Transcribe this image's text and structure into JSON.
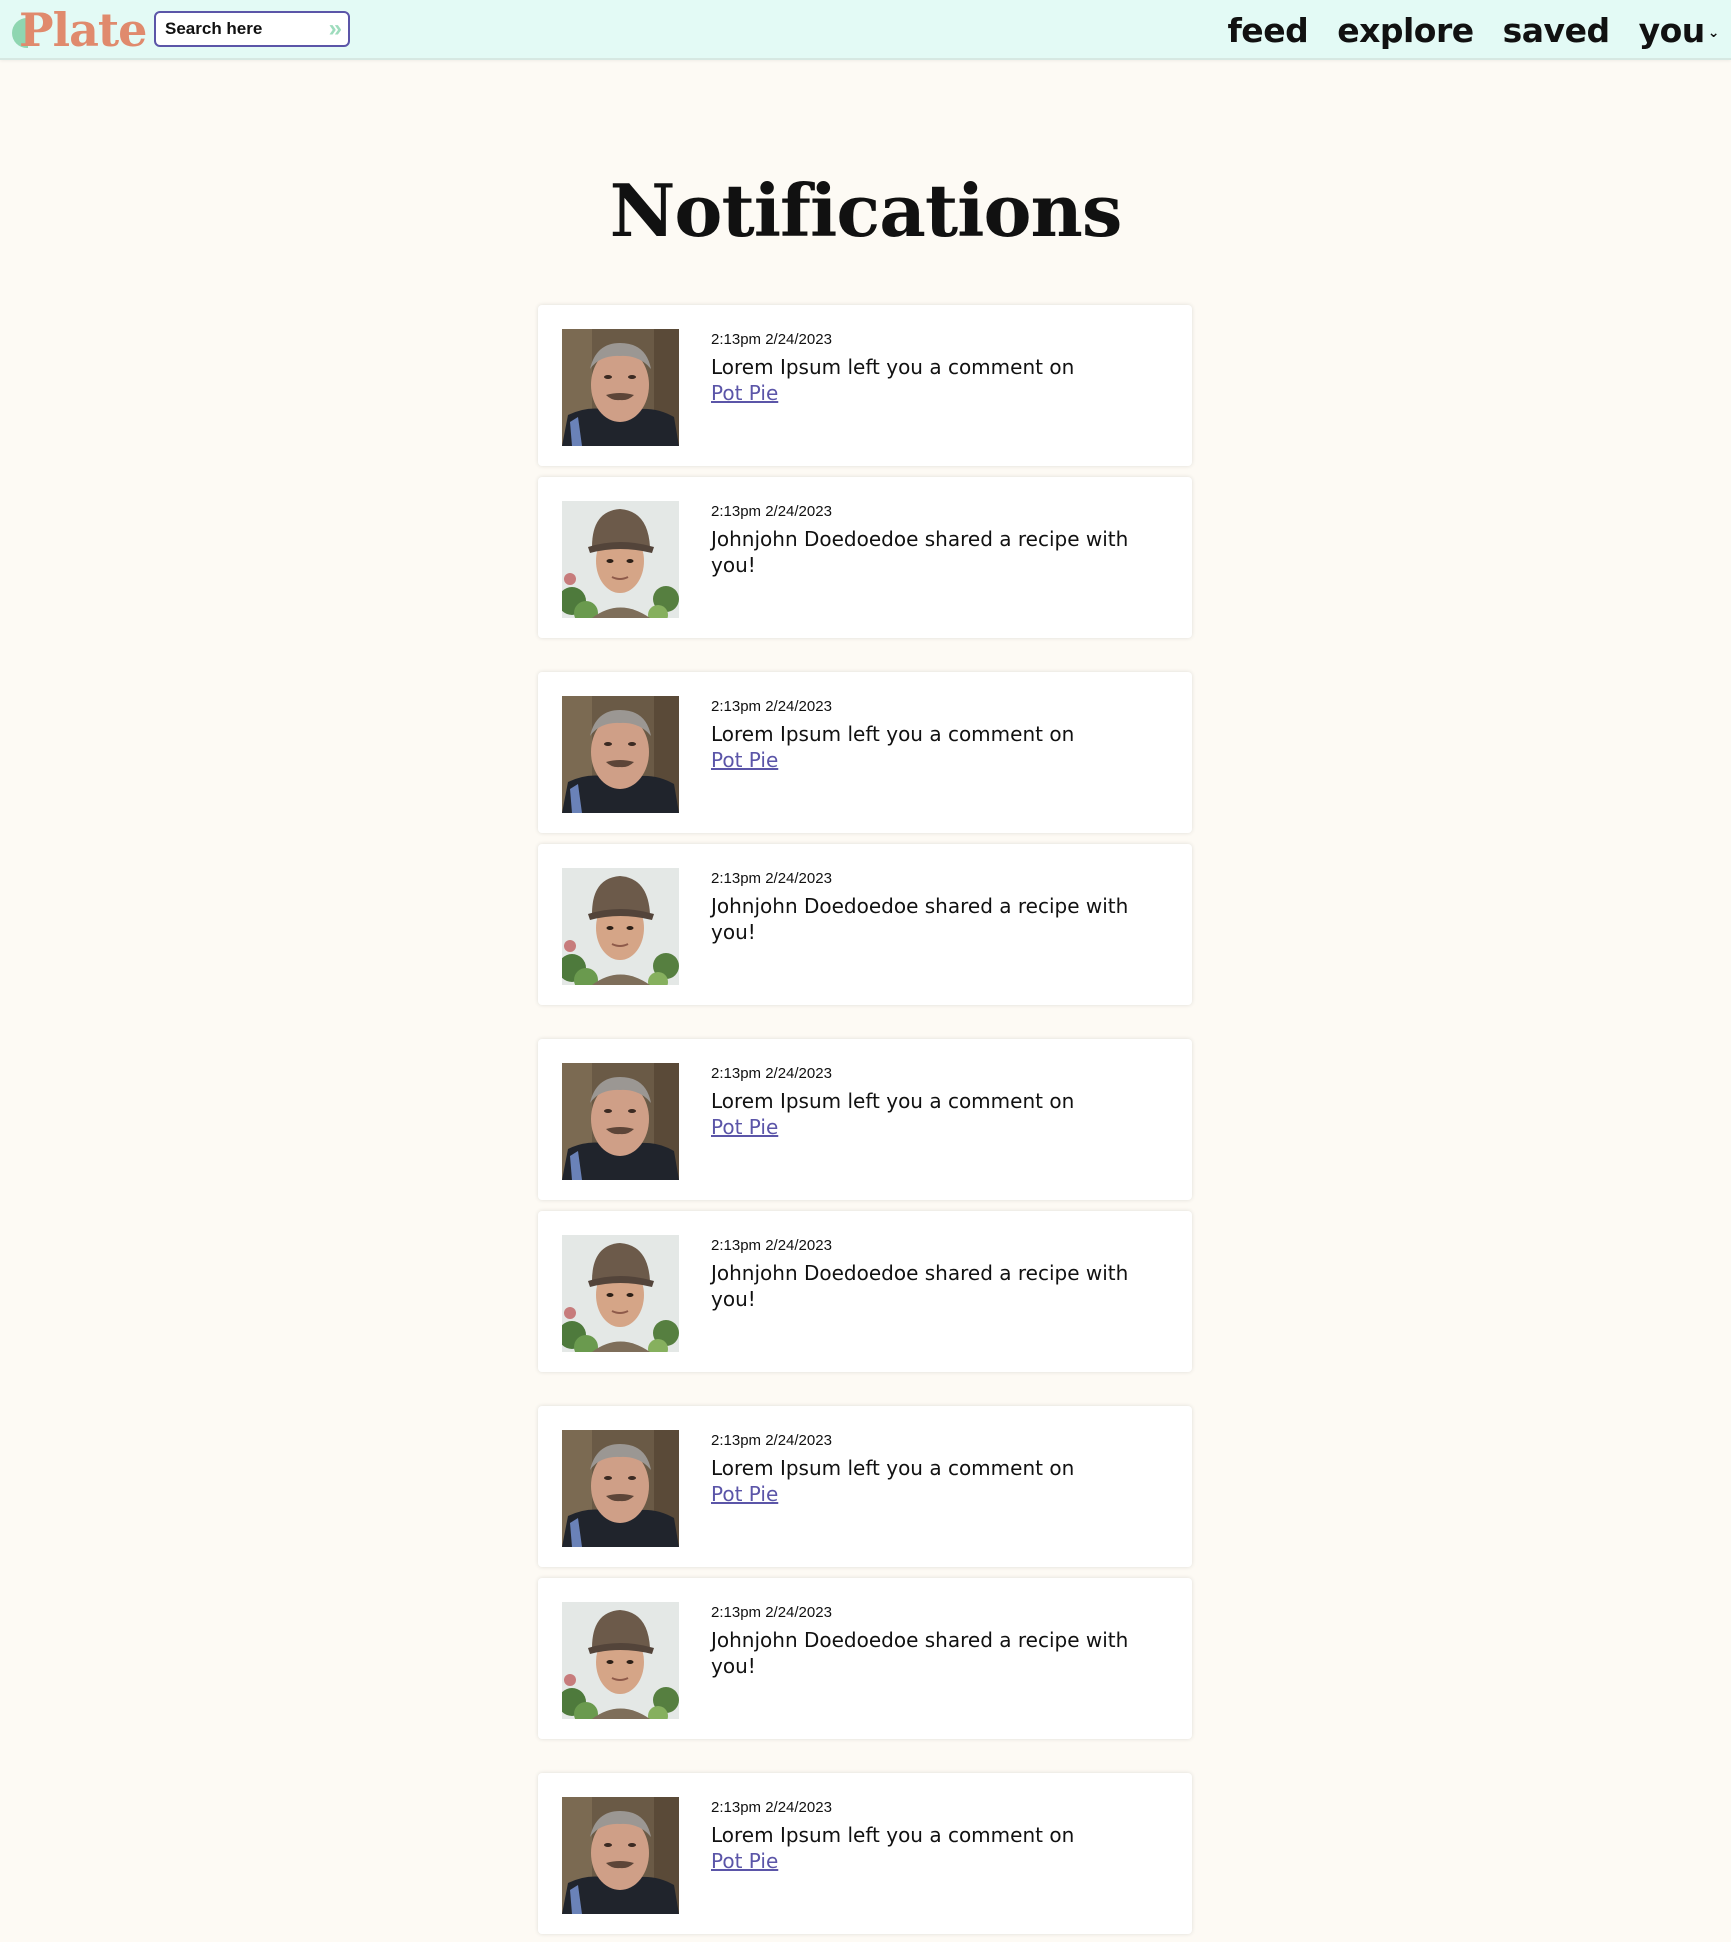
{
  "nav": {
    "logo": "Plate",
    "search_placeholder": "Search here",
    "search_go_icon": "double-chevron-right-icon",
    "links": [
      "feed",
      "explore",
      "saved",
      "you"
    ],
    "you_menu_icon": "chevron-down-icon"
  },
  "colors": {
    "navbar_background": "#e3faf5",
    "logo": "#e08a6d",
    "logo_accent": "#8fd6b1",
    "link": "#5b55a8",
    "page_background": "#fdfaf4"
  },
  "page_title": "Notifications",
  "notifications": [
    {
      "time": "2:13pm 2/24/2023",
      "avatar": "older-man-avatar",
      "message": "Lorem Ipsum left you a comment on",
      "link": "Pot Pie"
    },
    {
      "time": "2:13pm 2/24/2023",
      "avatar": "man-in-cap-avatar",
      "message": "Johnjohn Doedoedoe shared a recipe with you!",
      "link": ""
    },
    {
      "time": "2:13pm 2/24/2023",
      "avatar": "older-man-avatar",
      "message": "Lorem Ipsum left you a comment on",
      "link": "Pot Pie"
    },
    {
      "time": "2:13pm 2/24/2023",
      "avatar": "man-in-cap-avatar",
      "message": "Johnjohn Doedoedoe shared a recipe with you!",
      "link": ""
    },
    {
      "time": "2:13pm 2/24/2023",
      "avatar": "older-man-avatar",
      "message": "Lorem Ipsum left you a comment on",
      "link": "Pot Pie"
    },
    {
      "time": "2:13pm 2/24/2023",
      "avatar": "man-in-cap-avatar",
      "message": "Johnjohn Doedoedoe shared a recipe with you!",
      "link": ""
    },
    {
      "time": "2:13pm 2/24/2023",
      "avatar": "older-man-avatar",
      "message": "Lorem Ipsum left you a comment on",
      "link": "Pot Pie"
    },
    {
      "time": "2:13pm 2/24/2023",
      "avatar": "man-in-cap-avatar",
      "message": "Johnjohn Doedoedoe shared a recipe with you!",
      "link": ""
    },
    {
      "time": "2:13pm 2/24/2023",
      "avatar": "older-man-avatar",
      "message": "Lorem Ipsum left you a comment on",
      "link": "Pot Pie"
    }
  ]
}
